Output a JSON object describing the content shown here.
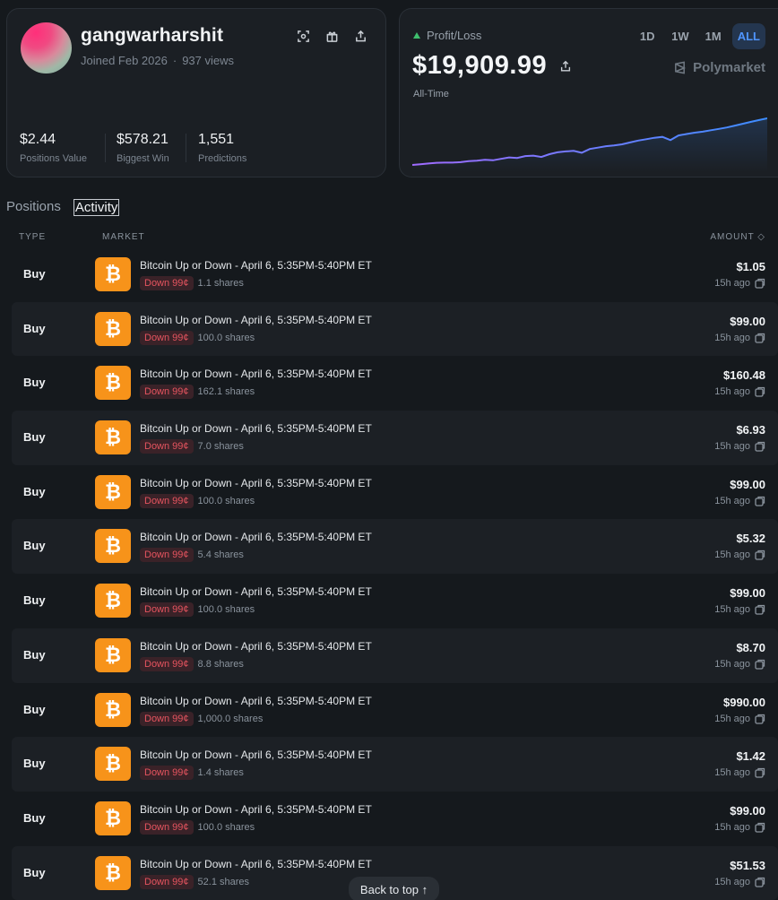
{
  "profile": {
    "username": "gangwarharshit",
    "joined": "Joined Feb 2026",
    "views": "937 views",
    "stats": [
      {
        "value": "$2.44",
        "label": "Positions Value"
      },
      {
        "value": "$578.21",
        "label": "Biggest Win"
      },
      {
        "value": "1,551",
        "label": "Predictions"
      }
    ]
  },
  "pnl": {
    "label": "Profit/Loss",
    "value": "$19,909.99",
    "period": "All-Time",
    "ranges": [
      "1D",
      "1W",
      "1M",
      "ALL"
    ],
    "active_range": "ALL",
    "brand": "Polymarket",
    "colors": {
      "up": "#3fbf6e",
      "line_start": "#a06bff",
      "line_end": "#3d8dff"
    }
  },
  "chart_data": {
    "type": "line",
    "series": [
      {
        "values": [
          0,
          0.3,
          0.6,
          0.9,
          1.0,
          1.0,
          1.2,
          1.6,
          1.8,
          2.2,
          2.0,
          2.6,
          3.2,
          3.0,
          3.8,
          4.0,
          3.4,
          4.6,
          5.4,
          5.8,
          6.0,
          5.2,
          6.8,
          7.4,
          8.0,
          8.3,
          8.8,
          9.6,
          10.4,
          11.0,
          11.6,
          12.0,
          10.6,
          12.6,
          13.2,
          13.8,
          14.2,
          14.8,
          15.4,
          16.0,
          16.8,
          17.6,
          18.4,
          19.2,
          19.909
        ]
      }
    ]
  },
  "tabs": [
    "Positions",
    "Activity"
  ],
  "active_tab": "Activity",
  "table": {
    "headers": {
      "type": "TYPE",
      "market": "MARKET",
      "amount": "AMOUNT ◇"
    },
    "rows": [
      {
        "type": "Buy",
        "title": "Bitcoin Up or Down - April 6, 5:35PM-5:40PM ET",
        "badge": "Down 99¢",
        "shares": "1.1 shares",
        "amount": "$1.05",
        "time": "15h ago"
      },
      {
        "type": "Buy",
        "title": "Bitcoin Up or Down - April 6, 5:35PM-5:40PM ET",
        "badge": "Down 99¢",
        "shares": "100.0 shares",
        "amount": "$99.00",
        "time": "15h ago"
      },
      {
        "type": "Buy",
        "title": "Bitcoin Up or Down - April 6, 5:35PM-5:40PM ET",
        "badge": "Down 99¢",
        "shares": "162.1 shares",
        "amount": "$160.48",
        "time": "15h ago"
      },
      {
        "type": "Buy",
        "title": "Bitcoin Up or Down - April 6, 5:35PM-5:40PM ET",
        "badge": "Down 99¢",
        "shares": "7.0 shares",
        "amount": "$6.93",
        "time": "15h ago"
      },
      {
        "type": "Buy",
        "title": "Bitcoin Up or Down - April 6, 5:35PM-5:40PM ET",
        "badge": "Down 99¢",
        "shares": "100.0 shares",
        "amount": "$99.00",
        "time": "15h ago"
      },
      {
        "type": "Buy",
        "title": "Bitcoin Up or Down - April 6, 5:35PM-5:40PM ET",
        "badge": "Down 99¢",
        "shares": "5.4 shares",
        "amount": "$5.32",
        "time": "15h ago"
      },
      {
        "type": "Buy",
        "title": "Bitcoin Up or Down - April 6, 5:35PM-5:40PM ET",
        "badge": "Down 99¢",
        "shares": "100.0 shares",
        "amount": "$99.00",
        "time": "15h ago"
      },
      {
        "type": "Buy",
        "title": "Bitcoin Up or Down - April 6, 5:35PM-5:40PM ET",
        "badge": "Down 99¢",
        "shares": "8.8 shares",
        "amount": "$8.70",
        "time": "15h ago"
      },
      {
        "type": "Buy",
        "title": "Bitcoin Up or Down - April 6, 5:35PM-5:40PM ET",
        "badge": "Down 99¢",
        "shares": "1,000.0 shares",
        "amount": "$990.00",
        "time": "15h ago"
      },
      {
        "type": "Buy",
        "title": "Bitcoin Up or Down - April 6, 5:35PM-5:40PM ET",
        "badge": "Down 99¢",
        "shares": "1.4 shares",
        "amount": "$1.42",
        "time": "15h ago"
      },
      {
        "type": "Buy",
        "title": "Bitcoin Up or Down - April 6, 5:35PM-5:40PM ET",
        "badge": "Down 99¢",
        "shares": "100.0 shares",
        "amount": "$99.00",
        "time": "15h ago"
      },
      {
        "type": "Buy",
        "title": "Bitcoin Up or Down - April 6, 5:35PM-5:40PM ET",
        "badge": "Down 99¢",
        "shares": "52.1 shares",
        "amount": "$51.53",
        "time": "15h ago"
      }
    ]
  },
  "coin_glyph": "₿",
  "back_to_top": "Back to top ↑"
}
